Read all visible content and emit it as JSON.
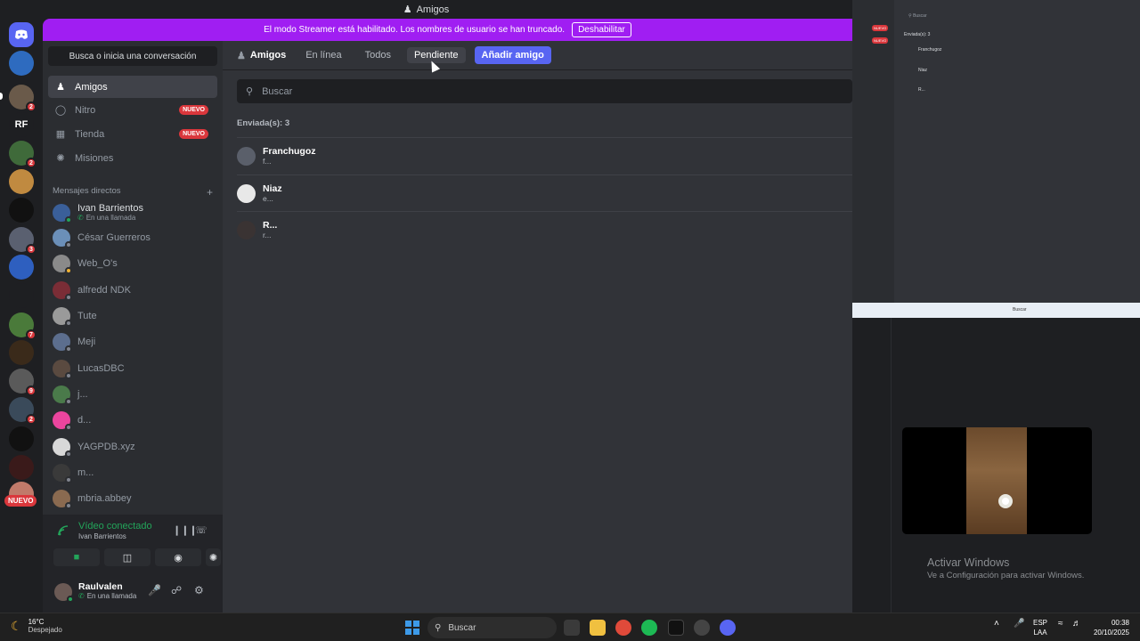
{
  "window": {
    "title": "Amigos"
  },
  "banner": {
    "text": "El modo Streamer está habilitado. Los nombres de usuario se han truncado.",
    "button": "Deshabilitar",
    "color": "#a01ef2"
  },
  "rail": {
    "label_rf": "RF",
    "new_badge": "NUEVO",
    "badges": [
      "2",
      "2",
      "3",
      "7",
      "9",
      "2"
    ]
  },
  "sidebar": {
    "search_label": "Busca o inicia una conversación",
    "nav": [
      {
        "label": "Amigos",
        "icon": "friends-icon"
      },
      {
        "label": "Nitro",
        "icon": "nitro-icon",
        "badge": "NUEVO"
      },
      {
        "label": "Tienda",
        "icon": "shop-icon",
        "badge": "NUEVO"
      },
      {
        "label": "Misiones",
        "icon": "quests-icon"
      }
    ],
    "dm_header": "Mensajes directos",
    "dm_add": "+",
    "dms": [
      {
        "name": "Ivan Barrientos",
        "sub": "En una llamada",
        "color": "#3a5f99"
      },
      {
        "name": "César Guerreros",
        "color": "#6b8fb8"
      },
      {
        "name": "Web_O's",
        "color": "#8a8a8a"
      },
      {
        "name": "alfredd NDK",
        "color": "#7a2d36"
      },
      {
        "name": "Tute",
        "color": "#9a9a9a"
      },
      {
        "name": "Meji",
        "color": "#5c6e8e"
      },
      {
        "name": "LucasDBC",
        "color": "#5a4a40"
      },
      {
        "name": "j...",
        "color": "#4a7a4a"
      },
      {
        "name": "d...",
        "color": "#eb459e"
      },
      {
        "name": "YAGPDB.xyz",
        "color": "#d8d8d8"
      },
      {
        "name": "m...",
        "color": "#3a3a3a"
      },
      {
        "name": "mbria.abbey",
        "color": "#8a6a50"
      }
    ]
  },
  "voice": {
    "title": "Vídeo conectado",
    "subtitle": "Ivan Barrientos"
  },
  "user": {
    "name": "Raulvalen",
    "status": "En una llamada"
  },
  "main": {
    "header": "Amigos",
    "tabs": [
      "En línea",
      "Todos",
      "Pendiente"
    ],
    "selected_tab": "Pendiente",
    "add_button": "Añadir amigo",
    "search_placeholder": "Buscar",
    "sent_label": "Enviada(s): 3",
    "rows": [
      {
        "name": "Franchugoz",
        "sub": "f...",
        "color": "#5a5f6a"
      },
      {
        "name": "Niaz",
        "sub": "e...",
        "color": "#e8e8e8"
      },
      {
        "name": "R...",
        "sub": "r...",
        "color": "#3a3333"
      }
    ]
  },
  "mini": {
    "search": "Buscar",
    "sent": "Enviada(s): 3",
    "rows": [
      "Franchugoz",
      "Niaz",
      "R..."
    ],
    "badge": "NUEVO",
    "taskbar_search": "Buscar"
  },
  "activate": {
    "title": "Activar Windows",
    "subtitle": "Ve a Configuración para activar Windows."
  },
  "taskbar": {
    "temp": "16°C",
    "weather": "Despejado",
    "search": "Buscar",
    "lang1": "ESP",
    "lang2": "LAA",
    "time": "00:38",
    "date": "20/10/2025"
  }
}
